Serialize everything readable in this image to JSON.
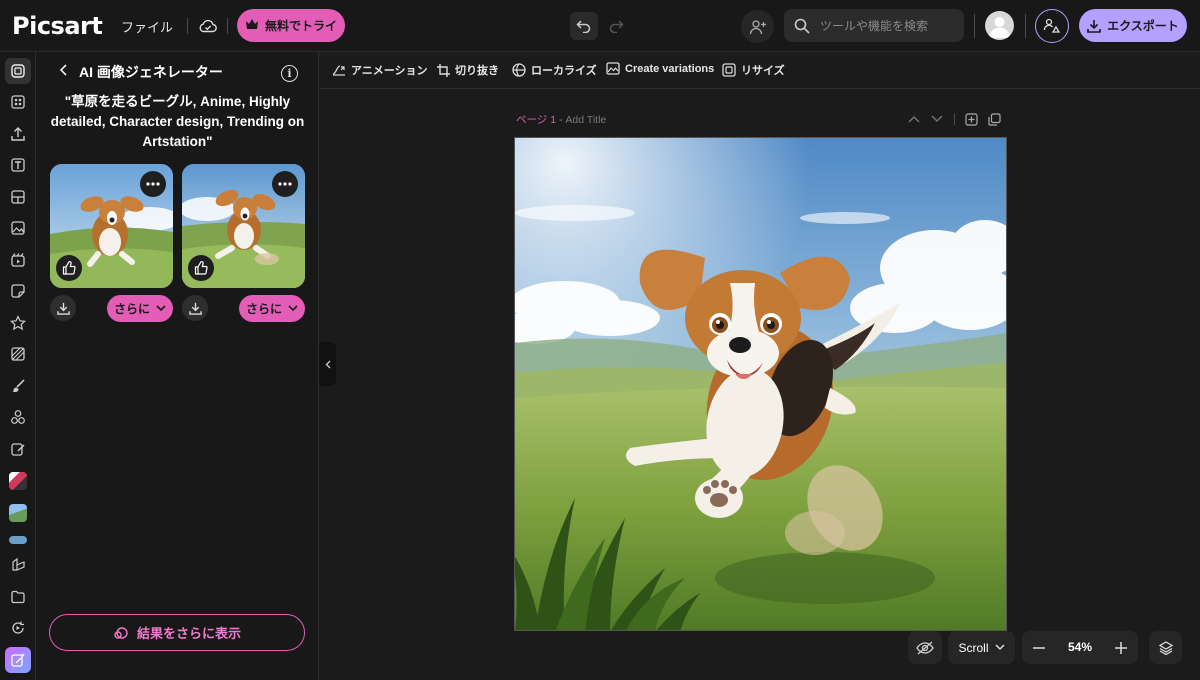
{
  "app": {
    "logo": "Picsart",
    "file_menu": "ファイル",
    "try_free": "無料でトライ",
    "search_placeholder": "ツールや機能を検索",
    "export": "エクスポート"
  },
  "panel": {
    "title": "AI 画像ジェネレーター",
    "prompt": "\"草原を走るビーグル, Anime, Highly detailed, Character design, Trending on Artstation\"",
    "more_label": "さらに",
    "show_more_results": "結果をさらに表示"
  },
  "toolbar": {
    "animation": "アニメーション",
    "crop": "切り抜き",
    "localize": "ローカライズ",
    "variations": "Create variations",
    "resize": "リサイズ"
  },
  "canvas": {
    "page_label": "ページ 1 -",
    "page_title_placeholder": "Add Title"
  },
  "bottom": {
    "scroll_label": "Scroll",
    "zoom": "54%"
  },
  "colors": {
    "accent_pink": "#e35cb6",
    "accent_purple": "#b3a0ff"
  }
}
